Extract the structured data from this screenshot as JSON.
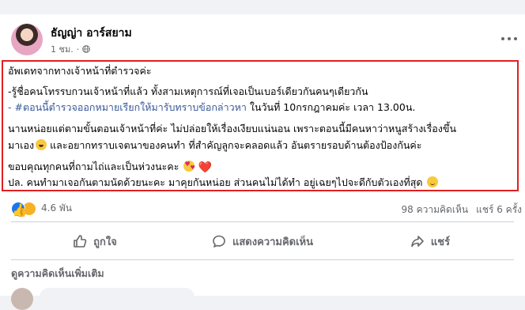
{
  "post": {
    "author": "ธัญญ่า อาร์สยาม",
    "time": "1 ชม.",
    "lines": {
      "l1": "อัพเดทจากทางเจ้าหน้าที่ตำรวจค่ะ",
      "l2": "-รู้ชื่อคนโทรรบกวนเจ้าหน้าที่แล้ว ทั้งสามเหตุการณ์ที่เจอเป็นเบอร์เดียวกันคนๆเดียวกัน",
      "l3_prefix": "- ",
      "l3_link": "#ตอนนี้ตำรวจออกหมายเรียกให้มารับทราบข้อกล่าวหา",
      "l3_rest": " ในวันที่ 10กรกฎาคมค่ะ เวลา 13.00น.",
      "l4": "นานหน่อยแต่ตามขั้นตอนเจ้าหน้าที่ค่ะ ไม่ปล่อยให้เรื่องเงียบแน่นอน เพราะตอนนี้มีคนหาว่าหนูสร้างเรื่องขึ้น",
      "l5a": "มาเอง",
      "l5b": " และอยากทราบเจตนาของคนทำ ที่สำคัญลูกจะคลอดแล้ว อันตรายรอบด้านต้องป้องกันค่ะ",
      "l6": "ขอบคุณทุกคนที่ถามไถ่และเป็นห่วงนะคะ",
      "l6_heart": "❤️",
      "l7": "ปล. คนทำมาเจอกันตามนัดด้วยนะคะ มาคุยกันหน่อย ส่วนคนไม่ได้ทำ อยู่เฉยๆไปจะดีกับตัวเองที่สุด"
    }
  },
  "stats": {
    "reactions": "4.6 พัน",
    "comments": "98 ความคิดเห็น",
    "shares": "แชร์ 6 ครั้ง"
  },
  "actions": {
    "like": "ถูกใจ",
    "comment": "แสดงความคิดเห็น",
    "share": "แชร์"
  },
  "comments_section": {
    "more": "ดูความคิดเห็นเพิ่มเติม"
  },
  "colors": {
    "highlight_border": "#e02020",
    "link": "#385898"
  }
}
